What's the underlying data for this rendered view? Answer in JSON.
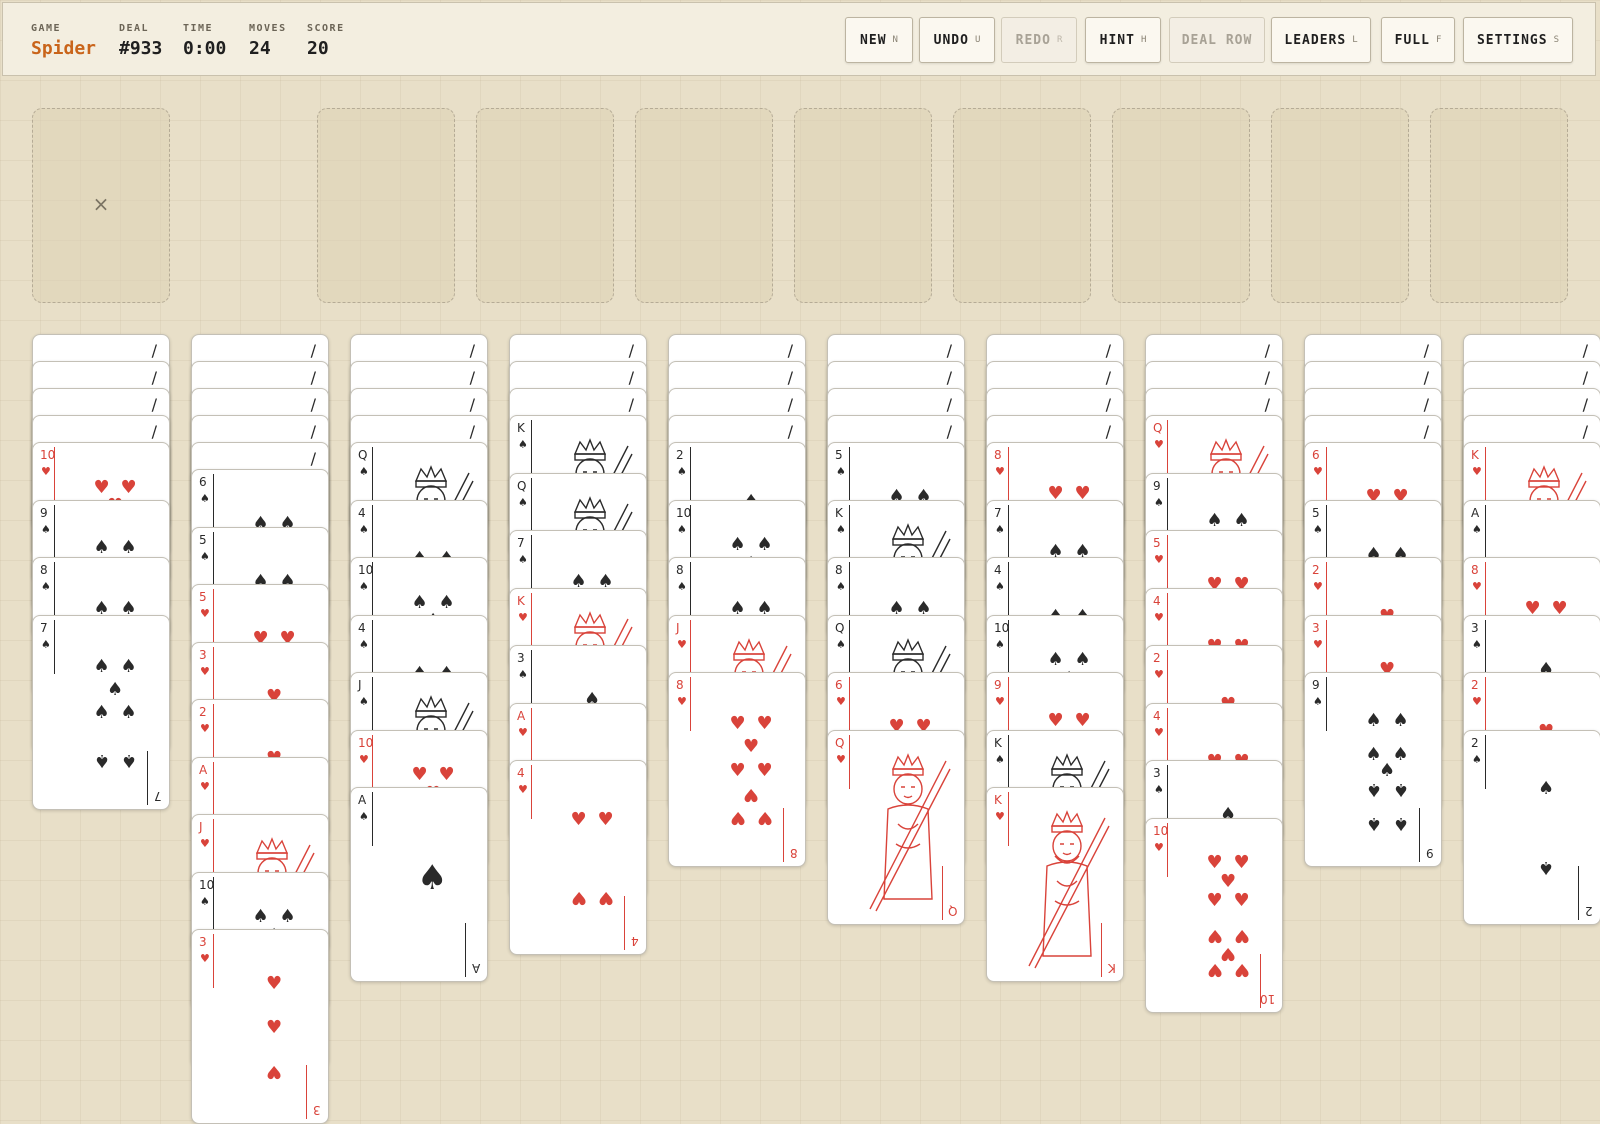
{
  "topbar": {
    "stats": [
      {
        "label": "GAME",
        "value": "Spider",
        "accent": true
      },
      {
        "label": "DEAL",
        "value": "#933",
        "accent": false
      },
      {
        "label": "TIME",
        "value": "0:00",
        "accent": false
      },
      {
        "label": "MOVES",
        "value": "24",
        "accent": false
      },
      {
        "label": "SCORE",
        "value": "20",
        "accent": false
      }
    ],
    "buttons": [
      {
        "label": "NEW",
        "key": "N",
        "enabled": true
      },
      {
        "label": "UNDO",
        "key": "U",
        "enabled": true
      },
      {
        "label": "REDO",
        "key": "R",
        "enabled": false
      },
      {
        "label": "HINT",
        "key": "H",
        "enabled": true
      },
      {
        "label": "DEAL ROW",
        "key": "",
        "enabled": false
      },
      {
        "label": "LEADERS",
        "key": "L",
        "enabled": true
      },
      {
        "label": "FULL",
        "key": "F",
        "enabled": true
      },
      {
        "label": "SETTINGS",
        "key": "S",
        "enabled": true
      }
    ]
  },
  "stock": {
    "empty_mark": "×"
  },
  "foundations": 8,
  "tableau": [
    {
      "down": 4,
      "up": [
        {
          "r": "10",
          "s": "♥"
        },
        {
          "r": "9",
          "s": "♠"
        },
        {
          "r": "8",
          "s": "♠"
        },
        {
          "r": "7",
          "s": "♠"
        }
      ]
    },
    {
      "down": 5,
      "up": [
        {
          "r": "6",
          "s": "♠"
        },
        {
          "r": "5",
          "s": "♠"
        },
        {
          "r": "5",
          "s": "♥"
        },
        {
          "r": "3",
          "s": "♥"
        },
        {
          "r": "2",
          "s": "♥"
        },
        {
          "r": "A",
          "s": "♥"
        },
        {
          "r": "J",
          "s": "♥"
        },
        {
          "r": "10",
          "s": "♠"
        },
        {
          "r": "3",
          "s": "♥"
        }
      ]
    },
    {
      "down": 4,
      "up": [
        {
          "r": "Q",
          "s": "♠"
        },
        {
          "r": "4",
          "s": "♠"
        },
        {
          "r": "10",
          "s": "♠"
        },
        {
          "r": "4",
          "s": "♠"
        },
        {
          "r": "J",
          "s": "♠"
        },
        {
          "r": "10",
          "s": "♥"
        },
        {
          "r": "A",
          "s": "♠"
        }
      ]
    },
    {
      "down": 3,
      "up": [
        {
          "r": "K",
          "s": "♠"
        },
        {
          "r": "Q",
          "s": "♠"
        },
        {
          "r": "7",
          "s": "♠"
        },
        {
          "r": "K",
          "s": "♥"
        },
        {
          "r": "3",
          "s": "♠"
        },
        {
          "r": "A",
          "s": "♥"
        },
        {
          "r": "4",
          "s": "♥"
        }
      ]
    },
    {
      "down": 4,
      "up": [
        {
          "r": "2",
          "s": "♠"
        },
        {
          "r": "10",
          "s": "♠"
        },
        {
          "r": "8",
          "s": "♠"
        },
        {
          "r": "J",
          "s": "♥"
        },
        {
          "r": "8",
          "s": "♥"
        }
      ]
    },
    {
      "down": 4,
      "up": [
        {
          "r": "5",
          "s": "♠"
        },
        {
          "r": "K",
          "s": "♠"
        },
        {
          "r": "8",
          "s": "♠"
        },
        {
          "r": "Q",
          "s": "♠"
        },
        {
          "r": "6",
          "s": "♥"
        },
        {
          "r": "Q",
          "s": "♥"
        }
      ]
    },
    {
      "down": 4,
      "up": [
        {
          "r": "8",
          "s": "♥"
        },
        {
          "r": "7",
          "s": "♠"
        },
        {
          "r": "4",
          "s": "♠"
        },
        {
          "r": "10",
          "s": "♠"
        },
        {
          "r": "9",
          "s": "♥"
        },
        {
          "r": "K",
          "s": "♠"
        },
        {
          "r": "K",
          "s": "♥"
        }
      ]
    },
    {
      "down": 3,
      "up": [
        {
          "r": "Q",
          "s": "♥"
        },
        {
          "r": "9",
          "s": "♠"
        },
        {
          "r": "5",
          "s": "♥"
        },
        {
          "r": "4",
          "s": "♥"
        },
        {
          "r": "2",
          "s": "♥"
        },
        {
          "r": "4",
          "s": "♥"
        },
        {
          "r": "3",
          "s": "♠"
        },
        {
          "r": "10",
          "s": "♥"
        }
      ]
    },
    {
      "down": 4,
      "up": [
        {
          "r": "6",
          "s": "♥"
        },
        {
          "r": "5",
          "s": "♠"
        },
        {
          "r": "2",
          "s": "♥"
        },
        {
          "r": "3",
          "s": "♥"
        },
        {
          "r": "9",
          "s": "♠"
        }
      ]
    },
    {
      "down": 4,
      "up": [
        {
          "r": "K",
          "s": "♥"
        },
        {
          "r": "A",
          "s": "♠"
        },
        {
          "r": "8",
          "s": "♥"
        },
        {
          "r": "3",
          "s": "♠"
        },
        {
          "r": "2",
          "s": "♥"
        },
        {
          "r": "2",
          "s": "♠"
        }
      ]
    }
  ],
  "colors": {
    "red": "#d9433a",
    "black": "#2a2a2a",
    "accent": "#c9641a"
  }
}
